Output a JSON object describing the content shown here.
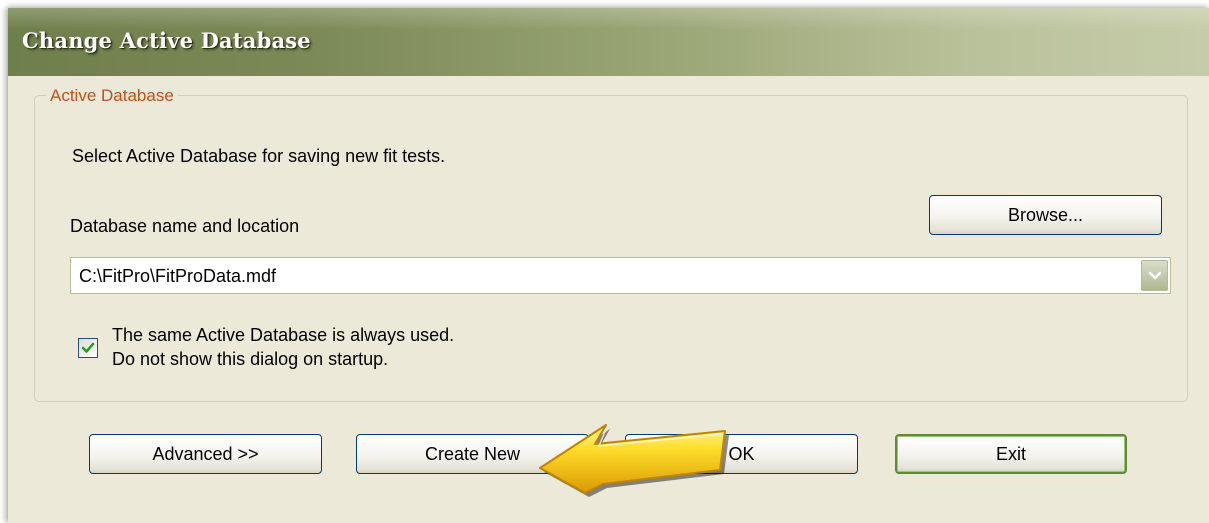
{
  "dialog": {
    "title": "Change Active Database"
  },
  "group": {
    "legend": "Active Database",
    "instruction": "Select Active Database for saving new fit tests.",
    "db_label": "Database name and location",
    "browse_label": "Browse...",
    "db_path": "C:\\FitPro\\FitProData.mdf",
    "checkbox_checked": true,
    "checkbox_line1": "The same Active Database is always used.",
    "checkbox_line2": "Do not show this dialog on startup."
  },
  "buttons": {
    "advanced": "Advanced >>",
    "create_new": "Create New",
    "ok": "OK",
    "exit": "Exit"
  },
  "icons": {
    "dropdown": "chevron-down-icon",
    "check": "check-icon",
    "pointer": "arrow-pointer-icon"
  },
  "colors": {
    "title_bar": "#7b8956",
    "legend_text": "#c0501c",
    "dialog_bg": "#ece9d8",
    "arrow": "#f2c200"
  }
}
